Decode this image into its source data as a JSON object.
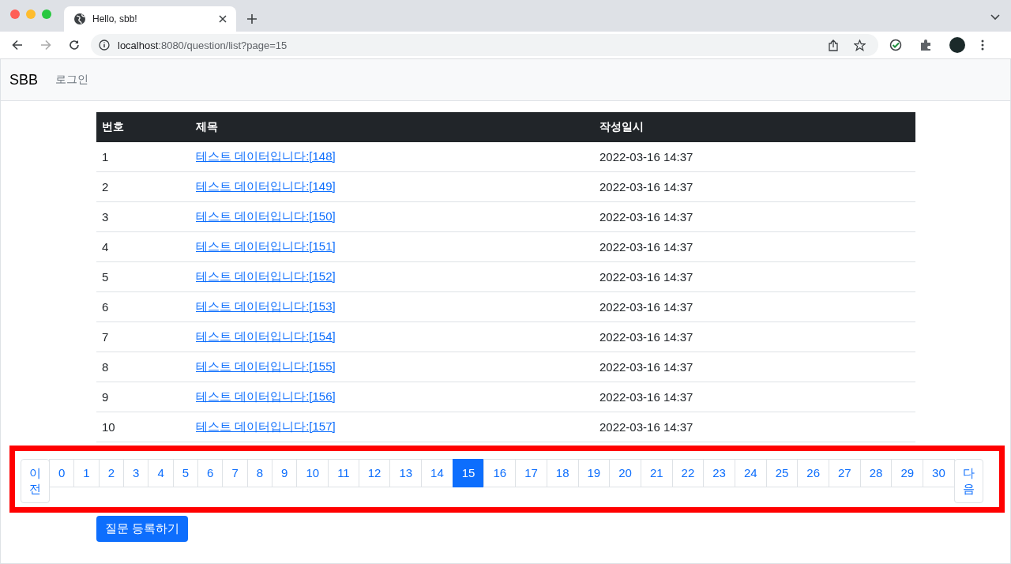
{
  "browser": {
    "tab_title": "Hello, sbb!",
    "url": "**localhost**:8080/question/list?page=15"
  },
  "navbar": {
    "brand": "SBB",
    "links": [
      {
        "label": "로그인"
      }
    ]
  },
  "table": {
    "columns": [
      "번호",
      "제목",
      "작성일시"
    ],
    "rows": [
      {
        "number": "1",
        "title": "테스트 데이터입니다:[148]",
        "date": "2022-03-16 14:37"
      },
      {
        "number": "2",
        "title": "테스트 데이터입니다:[149]",
        "date": "2022-03-16 14:37"
      },
      {
        "number": "3",
        "title": "테스트 데이터입니다:[150]",
        "date": "2022-03-16 14:37"
      },
      {
        "number": "4",
        "title": "테스트 데이터입니다:[151]",
        "date": "2022-03-16 14:37"
      },
      {
        "number": "5",
        "title": "테스트 데이터입니다:[152]",
        "date": "2022-03-16 14:37"
      },
      {
        "number": "6",
        "title": "테스트 데이터입니다:[153]",
        "date": "2022-03-16 14:37"
      },
      {
        "number": "7",
        "title": "테스트 데이터입니다:[154]",
        "date": "2022-03-16 14:37"
      },
      {
        "number": "8",
        "title": "테스트 데이터입니다:[155]",
        "date": "2022-03-16 14:37"
      },
      {
        "number": "9",
        "title": "테스트 데이터입니다:[156]",
        "date": "2022-03-16 14:37"
      },
      {
        "number": "10",
        "title": "테스트 데이터입니다:[157]",
        "date": "2022-03-16 14:37"
      }
    ]
  },
  "pagination": {
    "previous": "이전",
    "next": "다음",
    "pages": [
      {
        "label": "0",
        "selected": false
      },
      {
        "label": "1",
        "selected": false
      },
      {
        "label": "2",
        "selected": false
      },
      {
        "label": "3",
        "selected": false
      },
      {
        "label": "4",
        "selected": false
      },
      {
        "label": "5",
        "selected": false
      },
      {
        "label": "6",
        "selected": false
      },
      {
        "label": "7",
        "selected": false
      },
      {
        "label": "8",
        "selected": false
      },
      {
        "label": "9",
        "selected": false
      },
      {
        "label": "10",
        "selected": false
      },
      {
        "label": "11",
        "selected": false
      },
      {
        "label": "12",
        "selected": false
      },
      {
        "label": "13",
        "selected": false
      },
      {
        "label": "14",
        "selected": false
      },
      {
        "label": "15",
        "selected": true
      },
      {
        "label": "16",
        "selected": false
      },
      {
        "label": "17",
        "selected": false
      },
      {
        "label": "18",
        "selected": false
      },
      {
        "label": "19",
        "selected": false
      },
      {
        "label": "20",
        "selected": false
      },
      {
        "label": "21",
        "selected": false
      },
      {
        "label": "22",
        "selected": false
      },
      {
        "label": "23",
        "selected": false
      },
      {
        "label": "24",
        "selected": false
      },
      {
        "label": "25",
        "selected": false
      },
      {
        "label": "26",
        "selected": false
      },
      {
        "label": "27",
        "selected": false
      },
      {
        "label": "28",
        "selected": false
      },
      {
        "label": "29",
        "selected": false
      },
      {
        "label": "30",
        "selected": false
      }
    ]
  },
  "create_button": "질문 등록하기"
}
